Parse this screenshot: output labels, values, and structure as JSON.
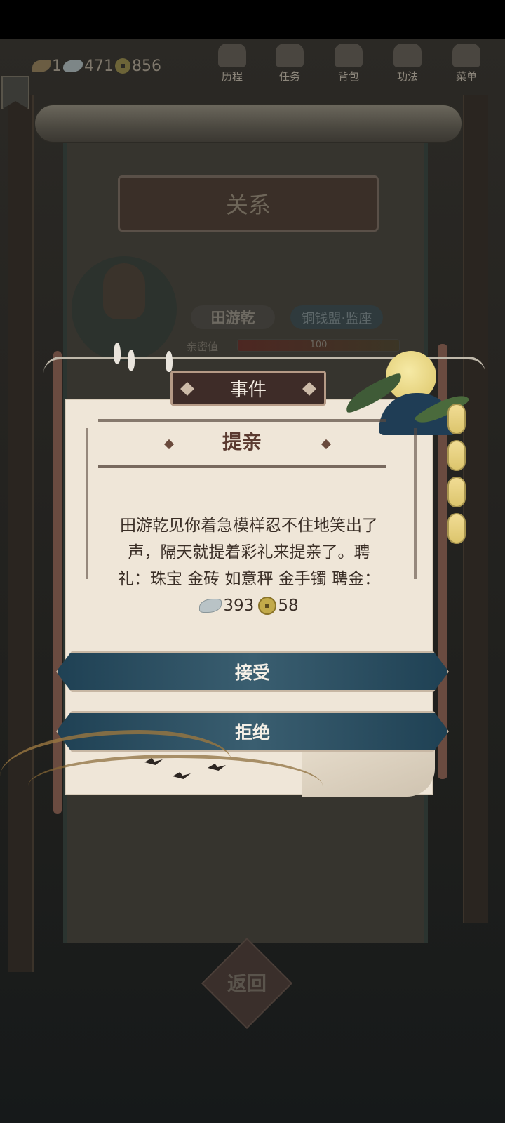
{
  "hud": {
    "currency": {
      "leaf": "1",
      "silver": "471",
      "coin": "856"
    },
    "nav": [
      {
        "label": "历程",
        "icon": "journey-icon"
      },
      {
        "label": "任务",
        "icon": "task-icon"
      },
      {
        "label": "背包",
        "icon": "bag-icon"
      },
      {
        "label": "功法",
        "icon": "scroll-icon"
      },
      {
        "label": "菜单",
        "icon": "menu-icon"
      }
    ]
  },
  "relation": {
    "title": "关系",
    "character": {
      "name": "田游乾",
      "title": "铜钱盟·监座",
      "intimacy_label": "亲密值",
      "intimacy_value": "100",
      "intimacy_fraction": 1.0
    },
    "back_label": "返回"
  },
  "event": {
    "header": "事件",
    "title": "提亲",
    "body_line1": "田游乾见你着急模样忍不住地笑出了",
    "body_line2": "声，隔天就提着彩礼来提亲了。聘",
    "body_line3": "礼：珠宝 金砖 如意秤 金手镯 聘金：",
    "reward_silver": "393",
    "reward_coin": "58",
    "accept_label": "接受",
    "decline_label": "拒绝"
  },
  "colors": {
    "paper": "#efe6d8",
    "button": "#2e5266",
    "header_bg": "#3e2c28",
    "title_text": "#5a3a30"
  }
}
